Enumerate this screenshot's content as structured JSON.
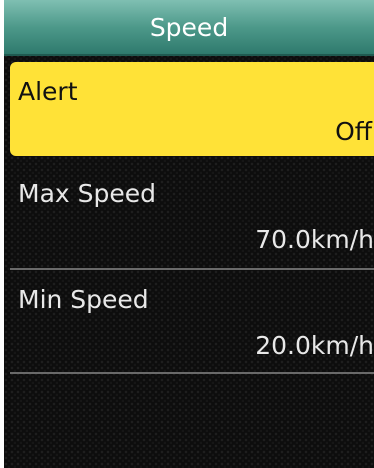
{
  "header": {
    "title": "Speed"
  },
  "menu": {
    "items": [
      {
        "label": "Alert",
        "value": "Off",
        "selected": true
      },
      {
        "label": "Max Speed",
        "value": "70.0km/h",
        "selected": false
      },
      {
        "label": "Min Speed",
        "value": "20.0km/h",
        "selected": false
      }
    ]
  },
  "colors": {
    "header_top": "#7fbfb2",
    "header_bottom": "#2f7a6d",
    "selected_background": "#ffe237",
    "screen_background": "#0d0d0d",
    "text_light": "#e8e8e8",
    "text_dark": "#111111"
  }
}
